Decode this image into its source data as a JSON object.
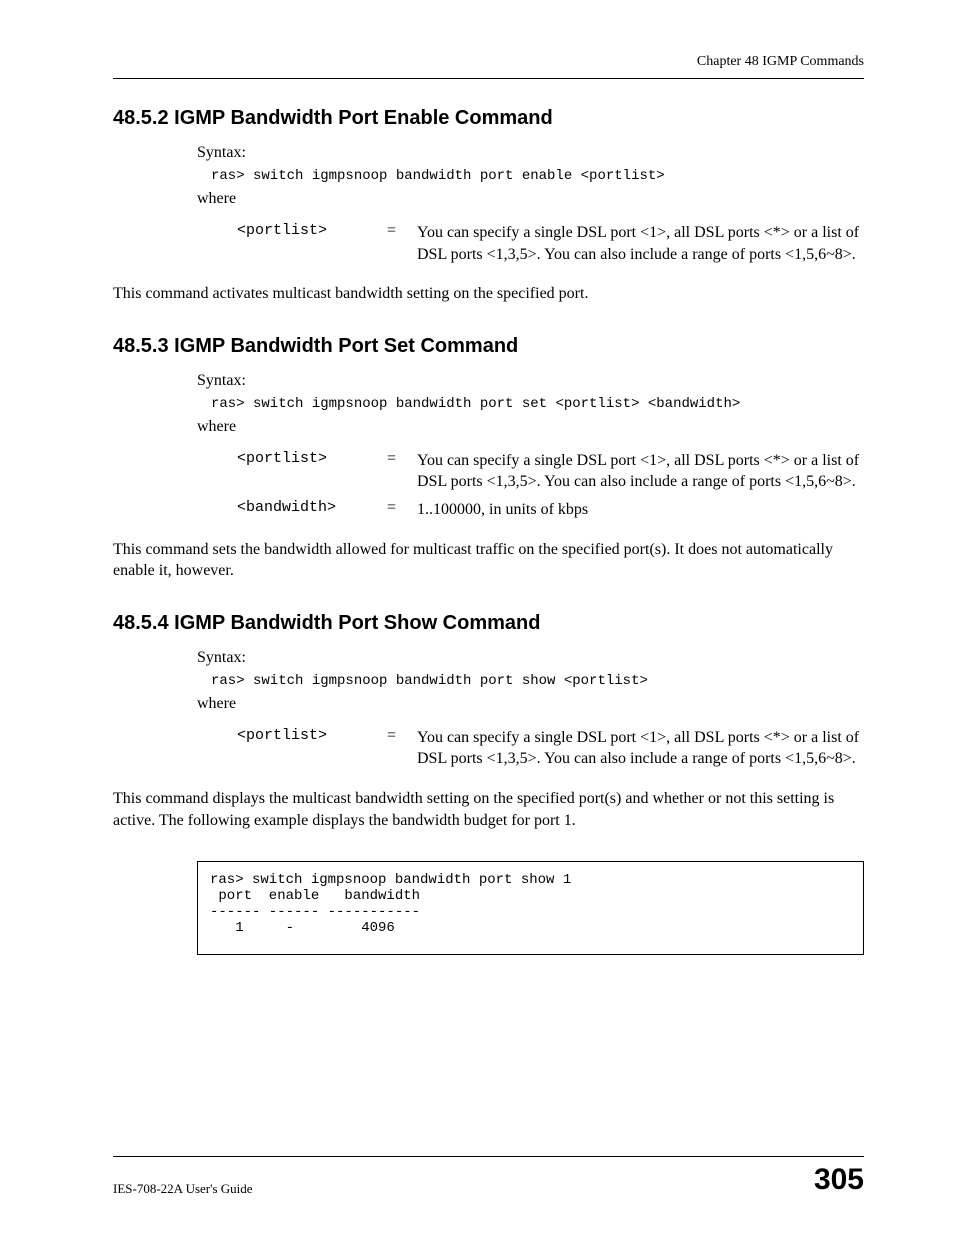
{
  "header": {
    "chapter": "Chapter 48 IGMP Commands"
  },
  "sections": {
    "s1": {
      "heading": "48.5.2  IGMP Bandwidth Port Enable Command",
      "syntax_label": "Syntax:",
      "code": "ras> switch igmpsnoop bandwidth port enable <portlist>",
      "where": "where",
      "params": {
        "p0": {
          "name": "<portlist>",
          "eq": "=",
          "desc": "You can specify a single DSL port <1>, all DSL ports <*> or a list of DSL ports <1,3,5>. You can also include a range of ports <1,5,6~8>."
        }
      },
      "body": "This command activates multicast bandwidth setting on the specified port."
    },
    "s2": {
      "heading": "48.5.3  IGMP Bandwidth Port Set Command",
      "syntax_label": "Syntax:",
      "code": "ras> switch igmpsnoop bandwidth port set <portlist> <bandwidth>",
      "where": "where",
      "params": {
        "p0": {
          "name": "<portlist>",
          "eq": "=",
          "desc": "You can specify a single DSL port <1>, all DSL ports <*> or a list of DSL ports <1,3,5>. You can also include a range of ports <1,5,6~8>."
        },
        "p1": {
          "name": "<bandwidth>",
          "eq": "=",
          "desc": "1..100000, in units of kbps"
        }
      },
      "body": "This command sets the bandwidth allowed for multicast traffic on the specified port(s). It does not automatically enable it, however."
    },
    "s3": {
      "heading": "48.5.4  IGMP Bandwidth Port Show Command",
      "syntax_label": "Syntax:",
      "code": "ras> switch igmpsnoop bandwidth port show <portlist>",
      "where": "where",
      "params": {
        "p0": {
          "name": "<portlist>",
          "eq": "=",
          "desc": "You can specify a single DSL port <1>, all DSL ports <*> or a list of DSL ports <1,3,5>. You can also include a range of ports <1,5,6~8>."
        }
      },
      "body": "This command displays the multicast bandwidth setting on the specified port(s) and whether or not this setting is active. The following example displays the bandwidth budget for port 1.",
      "example": "ras> switch igmpsnoop bandwidth port show 1\n port  enable   bandwidth\n------ ------ -----------\n   1     -        4096"
    }
  },
  "footer": {
    "guide": "IES-708-22A User's Guide",
    "page": "305"
  }
}
